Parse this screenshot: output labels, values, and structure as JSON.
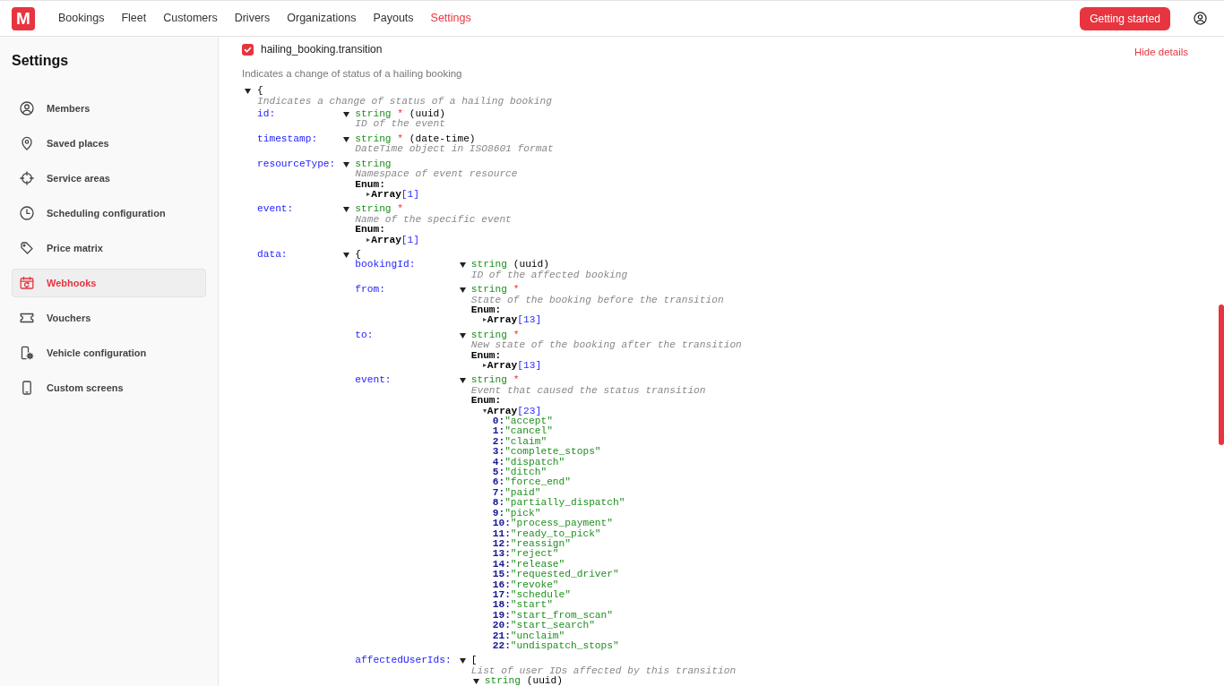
{
  "navbar": {
    "logo": "M",
    "items": [
      {
        "label": "Bookings",
        "selected": false
      },
      {
        "label": "Fleet",
        "selected": false
      },
      {
        "label": "Customers",
        "selected": false
      },
      {
        "label": "Drivers",
        "selected": false
      },
      {
        "label": "Organizations",
        "selected": false
      },
      {
        "label": "Payouts",
        "selected": false
      },
      {
        "label": "Settings",
        "selected": true
      }
    ],
    "cta": "Getting started"
  },
  "sidebar": {
    "title": "Settings",
    "items": [
      {
        "label": "Members",
        "selected": false
      },
      {
        "label": "Saved places",
        "selected": false
      },
      {
        "label": "Service areas",
        "selected": false
      },
      {
        "label": "Scheduling configuration",
        "selected": false
      },
      {
        "label": "Price matrix",
        "selected": false
      },
      {
        "label": "Webhooks",
        "selected": true
      },
      {
        "label": "Vouchers",
        "selected": false
      },
      {
        "label": "Vehicle configuration",
        "selected": false
      },
      {
        "label": "Custom screens",
        "selected": false
      }
    ]
  },
  "webhook": {
    "event": {
      "name": "hailing_booking.transition",
      "checked": true
    },
    "toggle_link": "Hide details",
    "description": "Indicates a change of status of a hailing booking",
    "schema": {
      "expanded": true,
      "open": "{",
      "description": "Indicates a change of status of a hailing booking",
      "properties": [
        {
          "kind": "scalar",
          "key": "id:",
          "expanded": true,
          "type": "string",
          "required_mark": "*",
          "format": "(uuid)",
          "description": "ID of the event"
        },
        {
          "kind": "scalar",
          "key": "timestamp:",
          "expanded": true,
          "type": "string",
          "required_mark": "*",
          "format": "(date-time)",
          "description": "DateTime object in ISO8601 format"
        },
        {
          "kind": "scalar",
          "key": "resourceType:",
          "expanded": true,
          "type": "string",
          "description": "Namespace of event resource",
          "enum": {
            "label": "Enum:",
            "expanded": false,
            "name": "Array",
            "count": "[1]"
          }
        },
        {
          "kind": "scalar",
          "key": "event:",
          "expanded": true,
          "type": "string",
          "required_mark": "*",
          "description": "Name of the specific event",
          "enum": {
            "label": "Enum:",
            "expanded": false,
            "name": "Array",
            "count": "[1]"
          }
        },
        {
          "kind": "object",
          "key": "data:",
          "expanded": true,
          "open": "{",
          "properties": [
            {
              "kind": "scalar",
              "key": "bookingId:",
              "expanded": true,
              "type": "string",
              "format": "(uuid)",
              "description": "ID of the affected booking"
            },
            {
              "kind": "scalar",
              "key": "from:",
              "expanded": true,
              "type": "string",
              "required_mark": "*",
              "description": "State of the booking before the transition",
              "enum": {
                "label": "Enum:",
                "expanded": false,
                "name": "Array",
                "count": "[13]"
              }
            },
            {
              "kind": "scalar",
              "key": "to:",
              "expanded": true,
              "type": "string",
              "required_mark": "*",
              "description": "New state of the booking after the transition",
              "enum": {
                "label": "Enum:",
                "expanded": false,
                "name": "Array",
                "count": "[13]"
              }
            },
            {
              "kind": "scalar",
              "key": "event:",
              "expanded": true,
              "type": "string",
              "required_mark": "*",
              "description": "Event that caused the status transition",
              "enum": {
                "label": "Enum:",
                "expanded": true,
                "name": "Array",
                "count": "[23]",
                "items": [
                  {
                    "index": "0:",
                    "value": "\"accept\""
                  },
                  {
                    "index": "1:",
                    "value": "\"cancel\""
                  },
                  {
                    "index": "2:",
                    "value": "\"claim\""
                  },
                  {
                    "index": "3:",
                    "value": "\"complete_stops\""
                  },
                  {
                    "index": "4:",
                    "value": "\"dispatch\""
                  },
                  {
                    "index": "5:",
                    "value": "\"ditch\""
                  },
                  {
                    "index": "6:",
                    "value": "\"force_end\""
                  },
                  {
                    "index": "7:",
                    "value": "\"paid\""
                  },
                  {
                    "index": "8:",
                    "value": "\"partially_dispatch\""
                  },
                  {
                    "index": "9:",
                    "value": "\"pick\""
                  },
                  {
                    "index": "10:",
                    "value": "\"process_payment\""
                  },
                  {
                    "index": "11:",
                    "value": "\"ready_to_pick\""
                  },
                  {
                    "index": "12:",
                    "value": "\"reassign\""
                  },
                  {
                    "index": "13:",
                    "value": "\"reject\""
                  },
                  {
                    "index": "14:",
                    "value": "\"release\""
                  },
                  {
                    "index": "15:",
                    "value": "\"requested_driver\""
                  },
                  {
                    "index": "16:",
                    "value": "\"revoke\""
                  },
                  {
                    "index": "17:",
                    "value": "\"schedule\""
                  },
                  {
                    "index": "18:",
                    "value": "\"start\""
                  },
                  {
                    "index": "19:",
                    "value": "\"start_from_scan\""
                  },
                  {
                    "index": "20:",
                    "value": "\"start_search\""
                  },
                  {
                    "index": "21:",
                    "value": "\"unclaim\""
                  },
                  {
                    "index": "22:",
                    "value": "\"undispatch_stops\""
                  }
                ]
              }
            },
            {
              "kind": "array",
              "key": "affectedUserIds:",
              "expanded": true,
              "open": "[",
              "description": "List of user IDs affected by this transition",
              "items": {
                "expanded": true,
                "type": "string",
                "format": "(uuid)"
              }
            }
          ]
        }
      ]
    }
  }
}
